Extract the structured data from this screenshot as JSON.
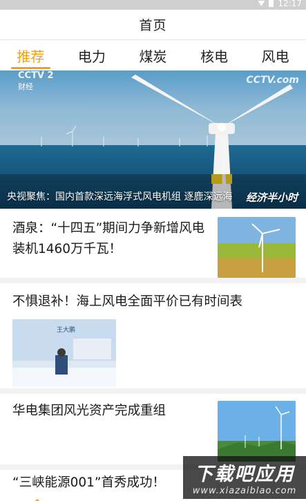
{
  "status_bar": {
    "time": "12:17"
  },
  "header": {
    "title": "首页"
  },
  "tabs": [
    {
      "label": "推荐",
      "active": true
    },
    {
      "label": "电力",
      "active": false
    },
    {
      "label": "煤炭",
      "active": false
    },
    {
      "label": "核电",
      "active": false
    },
    {
      "label": "风电",
      "active": false
    }
  ],
  "hero": {
    "channel_logo": "CCTV 2",
    "channel_name": "财经",
    "watermark": "CCTV.com",
    "caption": "央视聚焦：国内首款深远海浮式风电机组 逐鹿深远海",
    "program_logo": "经济半小时"
  },
  "news": [
    {
      "title": "酒泉：“十四五”期间力争新增风电装机1460万千瓦！"
    },
    {
      "title": "不惧退补！海上风电全面平价已有时间表",
      "thumb_speaker_name": "王大鹏"
    },
    {
      "title": "华电集团风光资产完成重组"
    },
    {
      "title": "“三峡能源001”首秀成功！"
    }
  ],
  "site_watermark": {
    "main": "下载吧应用",
    "url": "www.xiazaiblao.com"
  },
  "colors": {
    "accent": "#f0a020",
    "tab_text": "#222222",
    "divider": "#f2f2f2"
  }
}
